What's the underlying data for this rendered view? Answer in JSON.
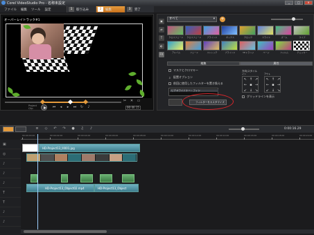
{
  "window": {
    "title": "Corel VideoStudio Pro - 名称未設定",
    "buttons": [
      "_",
      "□",
      "×"
    ]
  },
  "menu": [
    "ファイル",
    "編集",
    "ツール",
    "設定"
  ],
  "steps": [
    {
      "num": "1",
      "label": "取り込み"
    },
    {
      "num": "2",
      "label": "編集"
    },
    {
      "num": "3",
      "label": "完了"
    }
  ],
  "preview": {
    "overlay_label": "オーバーレイトラック#1",
    "timecode": "00:00:15",
    "project_label": "Project",
    "clip_label": "Clip"
  },
  "library": {
    "category": "すべて",
    "thumbs": [
      {
        "label": "クロスフェード",
        "c1": "#c05080",
        "c2": "#60c060"
      },
      {
        "label": "クロスフェード",
        "c1": "#3060c0",
        "c2": "#c04040"
      },
      {
        "label": "ブラインド",
        "c1": "#40a0e0",
        "c2": "#e060a0"
      },
      {
        "label": "ボックス",
        "c1": "#2040a0",
        "c2": "#80c0ff"
      },
      {
        "label": "クロック",
        "c1": "#e0a030",
        "c2": "#40a060"
      },
      {
        "label": "スライド",
        "c1": "#6080e0",
        "c2": "#e0e060"
      },
      {
        "label": "ズーム",
        "c1": "#40c080",
        "c2": "#e040a0"
      },
      {
        "label": "ワイプ",
        "c1": "#c0c0c0",
        "c2": "#60a030"
      },
      {
        "label": "アルバム",
        "c1": "#30a0d0",
        "c2": "#f0f060"
      },
      {
        "label": "フェード",
        "c1": "#e08040",
        "c2": "#40a0e0"
      },
      {
        "label": "ストレッチ",
        "c1": "#6040c0",
        "c2": "#e0c060"
      },
      {
        "label": "ブラインド",
        "c1": "#4080c0",
        "c2": "#c0e040"
      },
      {
        "label": "3Dトランジ",
        "c1": "#e06060",
        "c2": "#60c0e0"
      },
      {
        "label": "ページ",
        "c1": "#40c0c0",
        "c2": "#a040c0"
      },
      {
        "label": "フィルム",
        "c1": "#80e040",
        "c2": "#c04080"
      },
      {
        "label": "チェッカー",
        "c1": "#ffffff",
        "c2": "#111111"
      }
    ],
    "tabs": [
      "編集",
      "属性"
    ],
    "options": {
      "replace_filter": "マスクとクロマキー",
      "placement": "配置オプション",
      "last_used": "前回に使用したフィルターを置き換える",
      "fx_item": "ビデオワイドナー・フィン",
      "custom_button": "フィルターをカスタマイズ",
      "direction_label": "方向/スタイル",
      "in_label": "イン",
      "out_label": "アウト",
      "grid_label": "グリッドラインを表示"
    }
  },
  "timeline": {
    "timecode": "0:00:16.29",
    "ruler": [
      "00:00:00:00",
      "00:00:02:00",
      "00:00:04:00",
      "00:00:06:00",
      "00:00:08:00",
      "00:00:10:00",
      "00:00:12:00",
      "00:00:14:00",
      "00:00:16:00",
      "00:00:18:00",
      "00:00:20:00"
    ],
    "tracks": [
      "▣",
      "◎",
      "♪",
      "♪",
      "♪",
      "T",
      "T",
      "♪",
      "♪"
    ],
    "clips": {
      "title_clip": "HD-Project13_lll001.jpg",
      "overlay_clip_1": "HD-Project13_Object02.mp4",
      "overlay_clip_2": "HD-Project13_Object"
    }
  }
}
